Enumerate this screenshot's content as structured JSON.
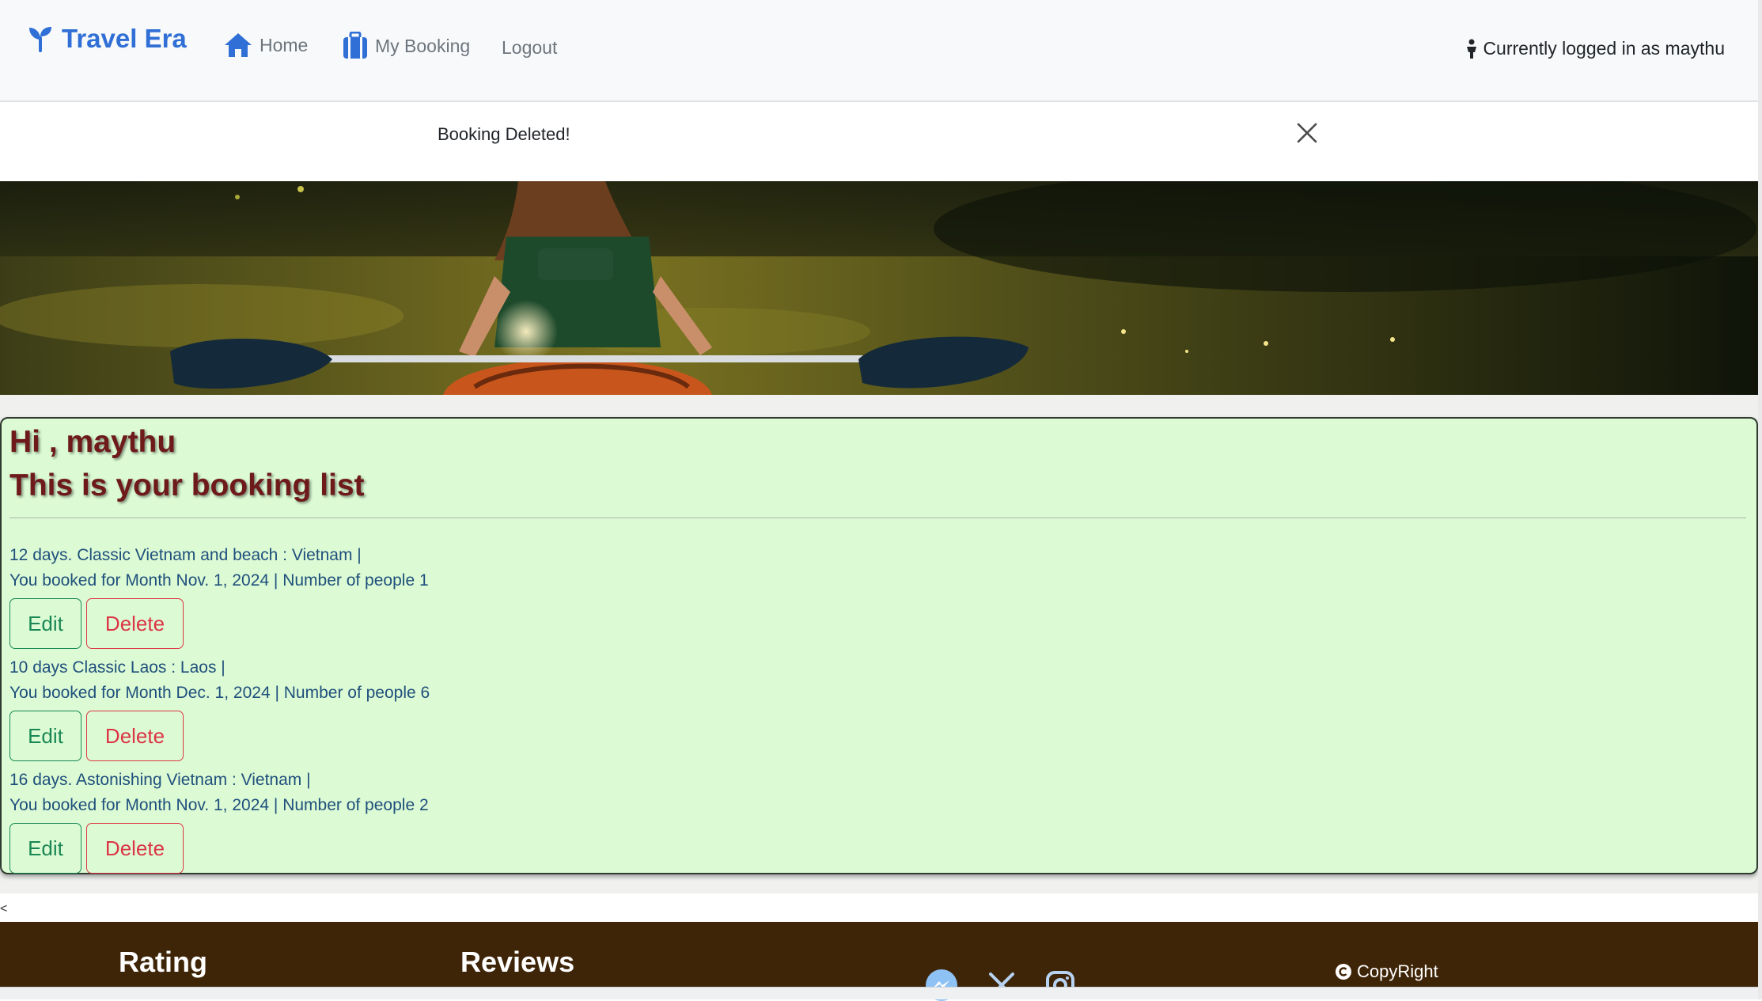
{
  "navbar": {
    "brand": "Travel Era",
    "home_label": "Home",
    "booking_label": "My Booking",
    "logout_label": "Logout",
    "login_status": "Currently logged in as maythu"
  },
  "alert": {
    "message": "Booking Deleted!"
  },
  "panel": {
    "greeting": "Hi , maythu",
    "subtitle": "This is your booking list",
    "bookings": [
      {
        "title": "12 days. Classic Vietnam and beach : Vietnam |",
        "detail": "You booked for Month Nov. 1, 2024 | Number of people 1",
        "edit_label": "Edit",
        "delete_label": "Delete"
      },
      {
        "title": "10 days Classic Laos : Laos |",
        "detail": "You booked for Month Dec. 1, 2024 | Number of people 6",
        "edit_label": "Edit",
        "delete_label": "Delete"
      },
      {
        "title": "16 days. Astonishing Vietnam : Vietnam |",
        "detail": "You booked for Month Nov. 1, 2024 | Number of people 2",
        "edit_label": "Edit",
        "delete_label": "Delete"
      }
    ]
  },
  "stray_glyph": "<",
  "footer": {
    "rating_title": "Rating",
    "reviews_title": "Reviews",
    "copyright": "CopyRight",
    "social_icons": [
      "messenger-icon",
      "x-icon",
      "instagram-icon"
    ]
  },
  "colors": {
    "brand": "#2f6fd6",
    "panel_bg": "#dcfbd4",
    "greeting": "#6e1a1a",
    "booking_text": "#1f4f7c",
    "edit": "#198754",
    "delete": "#dc3545",
    "footer_bg": "#3f2508"
  }
}
